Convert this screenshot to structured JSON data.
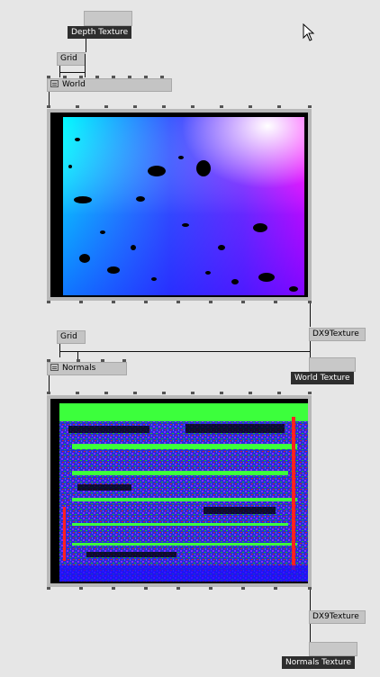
{
  "nodes": {
    "depth_texture_label": "Depth Texture",
    "grid_top": "Grid",
    "world": "World",
    "dx9_world": "DX9Texture",
    "world_texture_label": "World Texture",
    "grid_bottom": "Grid",
    "normals": "Normals",
    "dx9_normals": "DX9Texture",
    "normals_texture_label": "Normals Texture"
  },
  "icons": {
    "cursor": "mouse-pointer-icon",
    "node_menu": "menu-icon"
  },
  "colors": {
    "background": "#e6e6e6",
    "node_fill": "#c4c4c4",
    "label_fill": "#2e2e2e",
    "wire": "#111111"
  }
}
